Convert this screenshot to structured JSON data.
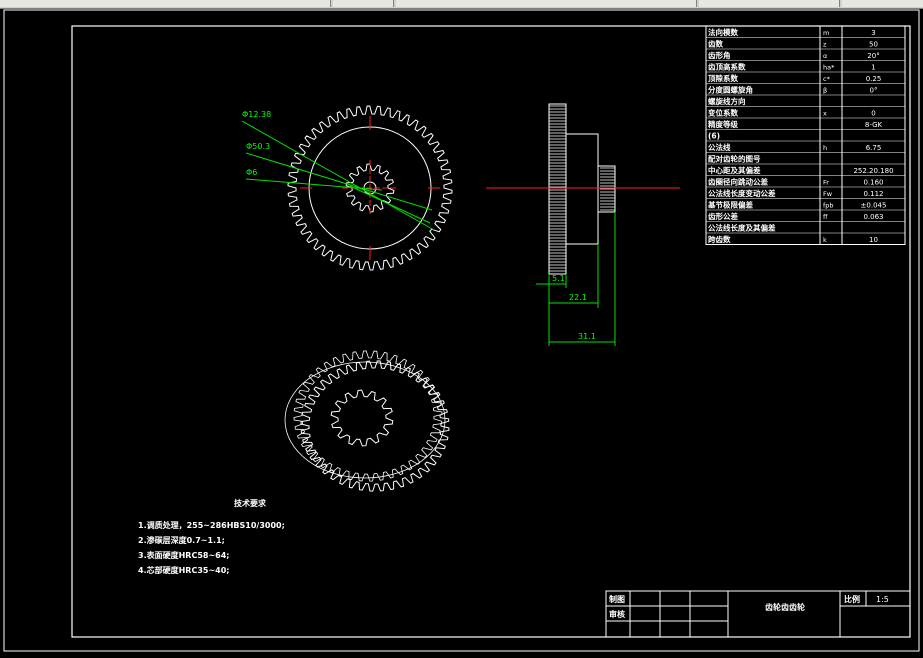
{
  "drawing": {
    "table_rows": [
      {
        "label": "法向模数",
        "sym": "m",
        "val": "3"
      },
      {
        "label": "齿数",
        "sym": "z",
        "val": "50"
      },
      {
        "label": "齿形角",
        "sym": "α",
        "val": "20°"
      },
      {
        "label": "齿顶高系数",
        "sym": "ha*",
        "val": "1"
      },
      {
        "label": "顶隙系数",
        "sym": "c*",
        "val": "0.25"
      },
      {
        "label": "分度圆螺旋角",
        "sym": "β",
        "val": "0°"
      },
      {
        "label": "螺旋线方向",
        "sym": "",
        "val": ""
      },
      {
        "label": "变位系数",
        "sym": "x",
        "val": "0"
      },
      {
        "label": "精度等级",
        "sym": "",
        "val": "8-GK"
      },
      {
        "label": "(6)",
        "sym": "",
        "val": ""
      },
      {
        "label": "公法线",
        "sym": "h",
        "val": "6.75"
      },
      {
        "label": "配对齿轮的图号",
        "sym": "",
        "val": ""
      },
      {
        "label": "中心距及其偏差",
        "sym": "",
        "val": "252.20.180"
      },
      {
        "label": "齿圈径向跳动公差",
        "sym": "Fr",
        "val": "0.160"
      },
      {
        "label": "公法线长度变动公差",
        "sym": "Fw",
        "val": "0.112"
      },
      {
        "label": "基节极限偏差",
        "sym": "fpb",
        "val": "±0.045"
      },
      {
        "label": "齿形公差",
        "sym": "ff",
        "val": "0.063"
      },
      {
        "label": "公法线长度及其偏差",
        "sym": "",
        "val": ""
      },
      {
        "label": "跨齿数",
        "sym": "k",
        "val": "10"
      }
    ],
    "dims": {
      "d1": "Φ12.38",
      "d2": "Φ50.3",
      "d3": "Φ6",
      "w1": "5.1",
      "w2": "22.1",
      "w3": "31.1"
    },
    "notes": {
      "title": "技术要求",
      "lines": [
        "1.调质处理，255~286HBS10/3000;",
        "2.渗碳层深度0.7~1.1;",
        "3.表面硬度HRC58~64;",
        "4.芯部硬度HRC35~40;"
      ]
    },
    "title_block": {
      "drafter": "制图",
      "checker": "审核",
      "part_name": "齿轮齿齿轮",
      "scale_label": "比例",
      "scale_value": "1:5"
    },
    "colors": {
      "line": "#ffffff",
      "center": "#ff2020",
      "dim": "#00e000",
      "dim_text": "#00ff00"
    }
  }
}
